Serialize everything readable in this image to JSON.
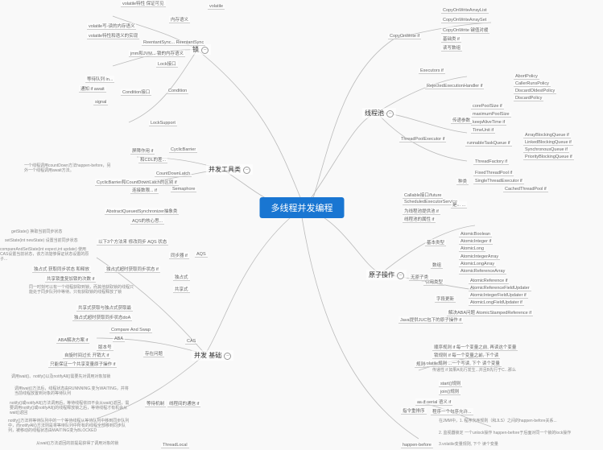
{
  "root": "多线程并发编程",
  "branches": {
    "lock": {
      "label": "锁"
    },
    "devtools": {
      "label": "并发工具类"
    },
    "devbasic": {
      "label": "并发 基础"
    },
    "threadpool": {
      "label": "线程池"
    },
    "atomic": {
      "label": "原子操作"
    }
  },
  "left": {
    "lock_group": {
      "volatile": "volatile",
      "volatile_feat1": "volatile特性 保证可见",
      "volatile_feat2": "内存语义",
      "volatile_rule1": "volatile写-读的内存语义",
      "volatile_rule2": "volatile特性和语义的实现",
      "reentrant_sync": "ReentantSync... ReentantSync",
      "sync_impl": "jmm和JVM... 锁的内存语义",
      "lock_label": "Lock接口",
      "condition_use": "等待队列  in...",
      "condition_await": "通知  if  await",
      "condition_signal": "signal",
      "condition_head": "Condition接口",
      "condition": "Condition",
      "locksupport": "LockSupport"
    },
    "devtools_group": {
      "cyclicbarrier_note": "屏障作用   if",
      "cyclicbarrier": "CyclicBarrier",
      "cyclicbarrier_sub": "和CDL的差...",
      "cdl_desc": "一个线程调用countDown方法happen-before，另外一个线程调用await方法。",
      "countdownlatch": "CountDownLatch",
      "countdownlatch_sub": "CyclicBarrier和CountDownLatch的区别   if",
      "semaphore_note": "连接数限...   if",
      "semaphore": "Semaphore"
    },
    "devbasic_group": {
      "aqs_title": "AbstractQueuedSynchronizer抽象类",
      "aqs_sub": "AQS的核心思...",
      "getstate": "getState()  换取当前同步状态",
      "setstate": "setState(int newState)  设置当前同步状态",
      "cas_state": "compareAndSetState(int expect,int update)  使用CAS设置当前状态，该方法能够保证状态设置的原子...",
      "aqs_methods": "以下3个方法来 修改同步  AQS 状态",
      "aqs_head": "同步器  if",
      "aqs_root": "AQS",
      "exclusive_note": "独占式 获取同步状态 和释放",
      "exclusive_desc": "独占式超时获取同步状态  if",
      "exclusive_more": "共享锁重复加锁的次数  if",
      "share_note": "同一时刻可以有一个线程获取到锁，而其他获取锁的线程只能处于同步队列中等待。只有获取锁的线程释放了锁",
      "share_lock": "共享式",
      "exclusive_lock": "独占式",
      "share_get": "共享式获取与独占式获取最",
      "share_get2": "独占式超时获取同步状态doA",
      "cas_title": "Compare And Swap",
      "cas_desc": "CAS",
      "aba": "ABA解决方案   if",
      "aba_title": "ABA",
      "version": "版本号",
      "spin": "自旋时间过长 开销大  if",
      "atomic_one": "只能保证一个共享变量原子操作  if",
      "cas_problems": "存在问题",
      "wait_notify": "调用wait()、notify()以及notifyAll()需要先对调用对象加锁",
      "wait_method": "调用wait()方法后，线程状态由RUNNNING.变为WAITING，并将当前线程放置到对象的等待队列",
      "notify_method": "notify()或notifyAll()方法调用后，等待线程依旧不会从wait()返回，需要调用notify()或notifyAll()的线程释放锁之后，等待线程才有机会从wait()返回",
      "notify_desc": "notify()方法将等待队列中的一个等待线程从等待队列中移到同步队列中，而notifyAll()方法则是将等待队列中所有的线程全部移到同步队列，被移动的线程状态由WAITING变为BLOCKED",
      "wait_return": "从wait()方法返回的前提是获得了调用对象的锁",
      "waitnotify_head": "等待机制",
      "thread_comm": "线程间的通信  if",
      "threadlocal": "ThreadLocal"
    }
  },
  "right": {
    "cow_group": {
      "cow": "CopyOnWrite   if",
      "cow_list": "CopyOnWriteArrayList",
      "cow_set": "CopyOnWriteArraySet",
      "cow_map1": "CopyOnWrite 键值对缓",
      "cow_map2": "基础类    if",
      "cow_sub": "读写数组"
    },
    "threadpool_group": {
      "executors": "Executors   if",
      "rejected_handler": "RejectedExecutionHandler   if",
      "abort_policy": "AbortPolicy",
      "caller_runs": "CallerRunsPolicy",
      "discard_oldest": "DiscardOldestPolicy",
      "discard_policy": "DiscardPolicy",
      "tpe": "ThreadPoolExecutor   if",
      "core_pool": "corePoolSize   if",
      "max_pool": "maximumPoolSize",
      "keepalive": "keepAliveTime   if",
      "timeunit": "TimeUnit   if",
      "params": "传递参数",
      "runnable_queue": "runnableTaskQueue   if",
      "array_bq": "ArrayBlockingQueue  if",
      "linked_bq": "LinkedBlockingQueue  if",
      "sync_queue": "SynchronousQueue  if",
      "priority_bq": "PriorityBlockingQueue  if",
      "thread_factory": "ThreadFactory   if",
      "fixed_pool": "FixedThreadPool   if",
      "single_pool": "SingleThreadExecutor   if",
      "cached_pool": "CachedThreadPool   if",
      "types": "种类",
      "callable": "Callable接口/future",
      "scheduled": "ScheduledExecutorService",
      "pool_method": "为线程池提供池   if",
      "pool_attr": "线程池的属性   if",
      "pool_note": "是... ..."
    },
    "atomic_group": {
      "atomic_bool": "AtomicBoolean",
      "atomic_int": "AtomicInteger  if",
      "atomic_long": "AtomicLong",
      "atomic_int_arr": "AtomicIntegerArray",
      "atomic_long_arr": "AtomicLongArray",
      "atomic_ref_arr": "AtomicReferenceArray",
      "atomic_ref": "AtomicReference  if",
      "ref_field": "AtomicReferenceFieldUpdater",
      "int_field": "AtomicIntegerFieldUpdater  if",
      "long_field": "AtomicLongFieldUpdater  if",
      "stamped": "解决ABA问题 AtomicStampedReference  if",
      "juc_atomic": "Java提供JUC包下的原子操作  if",
      "basic_type": "基本类型",
      "array_type": "数组",
      "ref_type": "引用类型",
      "field_type": "字段更新",
      "no_atomic": "无原子类",
      "hb_rules": "顺序规则  if  每一个变量之前, 再读这个变量",
      "hb_rule2": "锁规则    if   每一个变量之前, 下个读",
      "hb_rule3": "volatile规则     ...一个写读, 下个 读个变量",
      "hb_trans": "传递性   if   如果A先行发生...并且B先行于C...那么",
      "hb_start": "start()规则",
      "hb_join": "join()规则",
      "hb_head": "规则",
      "asif_serial": "as-if-serial 语义   if",
      "reorder": "指令重排序",
      "reorder_sub": "程序一个句序允许...",
      "hb_jmm": "在JMM中，1. 程序次序规则（和JLS）之间的happen-before关系...",
      "hb_lock": "2. 监视器锁定 一个unlock操作 happen-before于后面对同一个锁的lock操作",
      "hb_vol": "3.volatile变量规则, 下个 读个变量",
      "hb_head2": "happen-before"
    }
  }
}
